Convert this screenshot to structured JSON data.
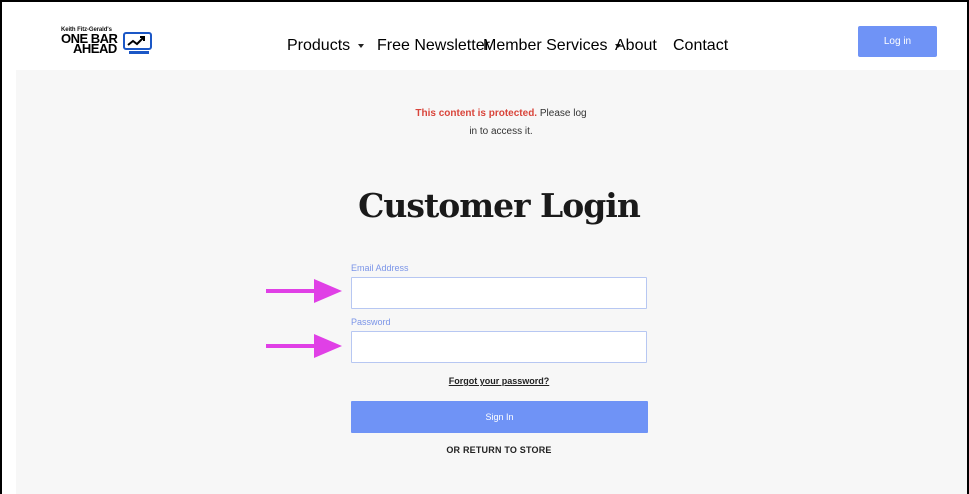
{
  "header": {
    "logo": {
      "small_text": "Keith Fitz-Gerald's",
      "line1": "ONE BAR",
      "line2": "AHEAD"
    },
    "nav": [
      {
        "label": "Products",
        "has_dropdown": true
      },
      {
        "label": "Free Newsletter",
        "has_dropdown": false
      },
      {
        "label": "Member Services",
        "has_dropdown": true
      },
      {
        "label": "About",
        "has_dropdown": false
      },
      {
        "label": "Contact",
        "has_dropdown": false
      }
    ],
    "login_label": "Log in"
  },
  "notice": {
    "protected": "This content is protected.",
    "message_part1": " Please log",
    "message_part2": "in to access it."
  },
  "title": "Customer Login",
  "form": {
    "email_label": "Email Address",
    "email_value": "",
    "password_label": "Password",
    "password_value": "",
    "forgot_label": "Forgot your password?",
    "signin_label": "Sign In",
    "return_label": "OR RETURN TO STORE"
  },
  "colors": {
    "accent": "#6f93f6",
    "warning": "#d9453b",
    "arrow": "#e040e6",
    "label": "#7b95e8"
  },
  "icons": {
    "logo_chart": "trend-chart-icon",
    "annotation": "arrow-right-icon"
  }
}
